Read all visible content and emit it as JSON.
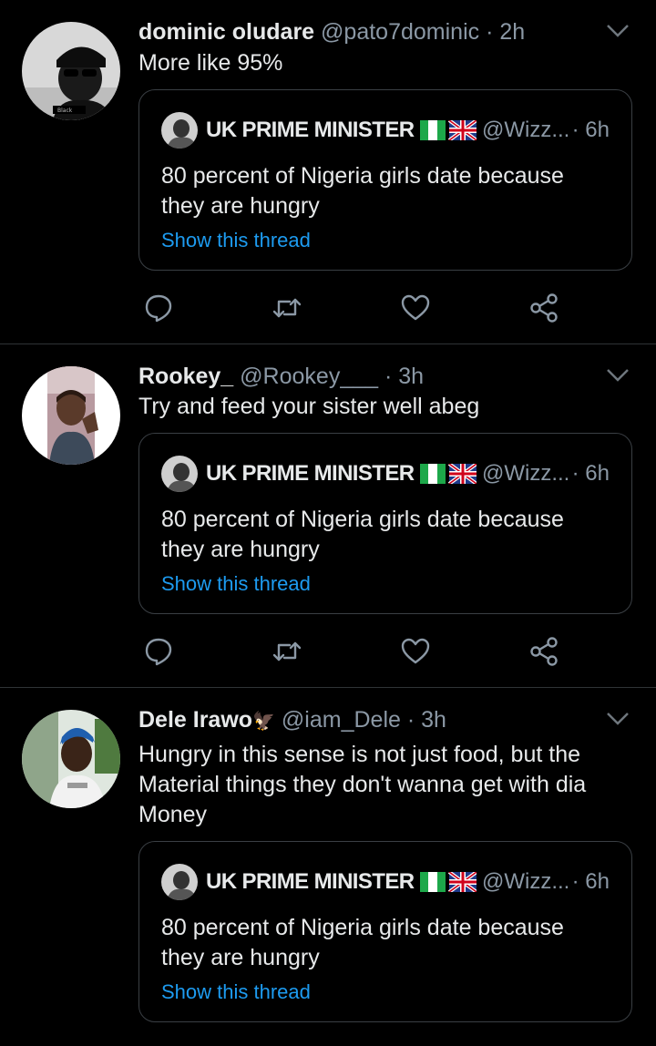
{
  "tweets": [
    {
      "name": "dominic oludare",
      "badge": "",
      "handle": "@pato7dominic",
      "dot": " · ",
      "time": "2h",
      "text": "More like 95%",
      "avatar_caption": "Black",
      "quote": {
        "name": "UK PRIME MINISTER",
        "handle": "@Wizz...",
        "time": "· 6h",
        "text": "80 percent of Nigeria girls date because they are hungry",
        "link": "Show this thread"
      }
    },
    {
      "name": "Rookey_",
      "badge": "",
      "handle": "@Rookey___",
      "dot": " · ",
      "time": "3h",
      "text": "Try and feed your sister well abeg",
      "quote": {
        "name": "UK PRIME MINISTER",
        "handle": "@Wizz...",
        "time": "· 6h",
        "text": "80 percent of Nigeria girls date because they are hungry",
        "link": "Show this thread"
      }
    },
    {
      "name": "Dele Irawo",
      "badge": "🦅",
      "handle": "@iam_Dele",
      "dot": " · ",
      "time": "3h",
      "text": "Hungry in this sense is not just food, but the Material things they don't wanna get with dia Money",
      "quote": {
        "name": "UK PRIME MINISTER",
        "handle": "@Wizz...",
        "time": "· 6h",
        "text": "80 percent of Nigeria girls date because they are hungry",
        "link": "Show this thread"
      }
    }
  ],
  "icons": [
    "reply-icon",
    "retweet-icon",
    "like-icon",
    "share-icon",
    "chevron-down-icon"
  ],
  "colors": {
    "background": "#000000",
    "text": "#e7e9ea",
    "secondary": "#8b98a5",
    "link": "#1d9bf0",
    "divider": "#2f3336"
  }
}
